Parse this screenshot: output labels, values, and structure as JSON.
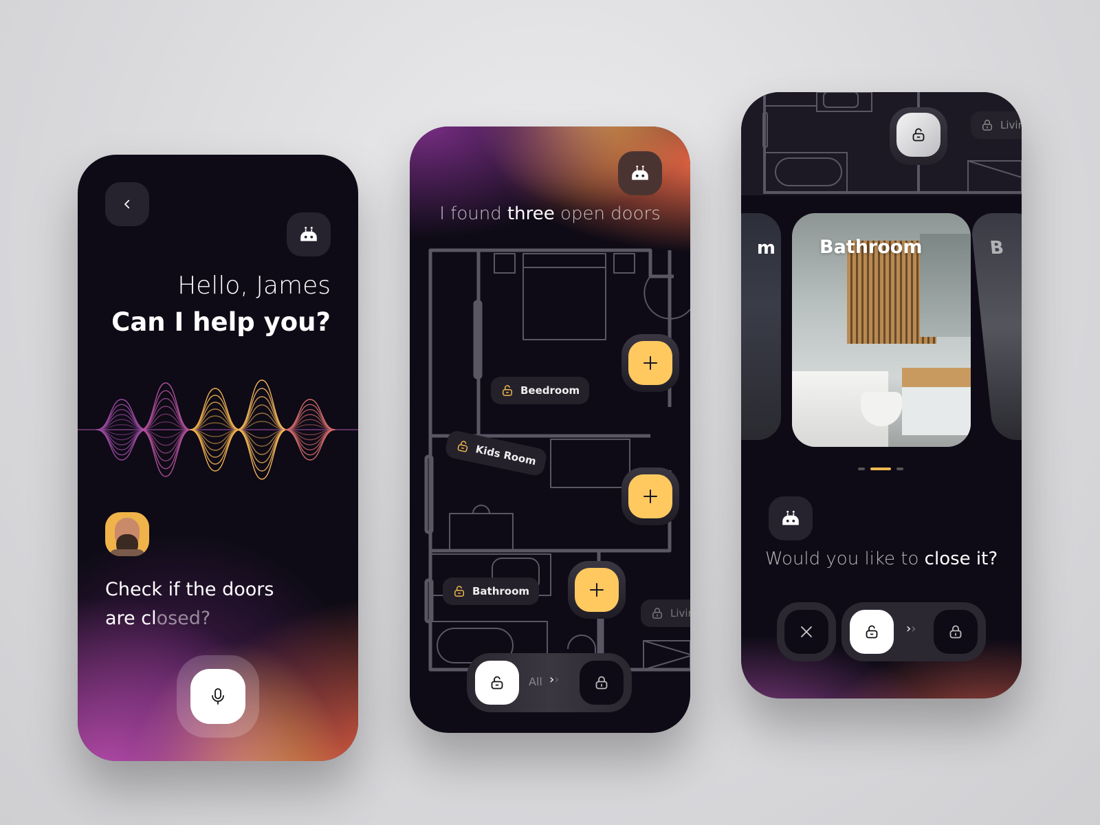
{
  "colors": {
    "accent": "#ffc960",
    "background": "#0e0b16",
    "surface": "#26222e"
  },
  "screen1": {
    "greeting": "Hello, James",
    "question": "Can I help you?",
    "user_message_line1": "Check if the doors",
    "user_message_line2_bright": "are cl",
    "user_message_line2_dim": "osed?",
    "icons": {
      "back": "chevron-left-icon",
      "assistant": "robot-icon",
      "mic": "microphone-icon"
    }
  },
  "screen2": {
    "message_pre": "I found ",
    "message_bold": "three",
    "message_post": " open doors",
    "rooms": [
      {
        "label": "Beedroom",
        "state": "unlocked"
      },
      {
        "label": "Kids Room",
        "state": "unlocked"
      },
      {
        "label": "Bathroom",
        "state": "unlocked"
      },
      {
        "label": "Livin",
        "state": "locked"
      }
    ],
    "control": {
      "label": "All"
    }
  },
  "screen3": {
    "chip_label": "Livin",
    "card_title": "Bathroom",
    "left_card_fragment": "m",
    "right_card_fragment": "B",
    "carousel": {
      "count": 3,
      "active": 2
    },
    "message_pre": "Would you like to ",
    "message_bold": "close it?"
  }
}
